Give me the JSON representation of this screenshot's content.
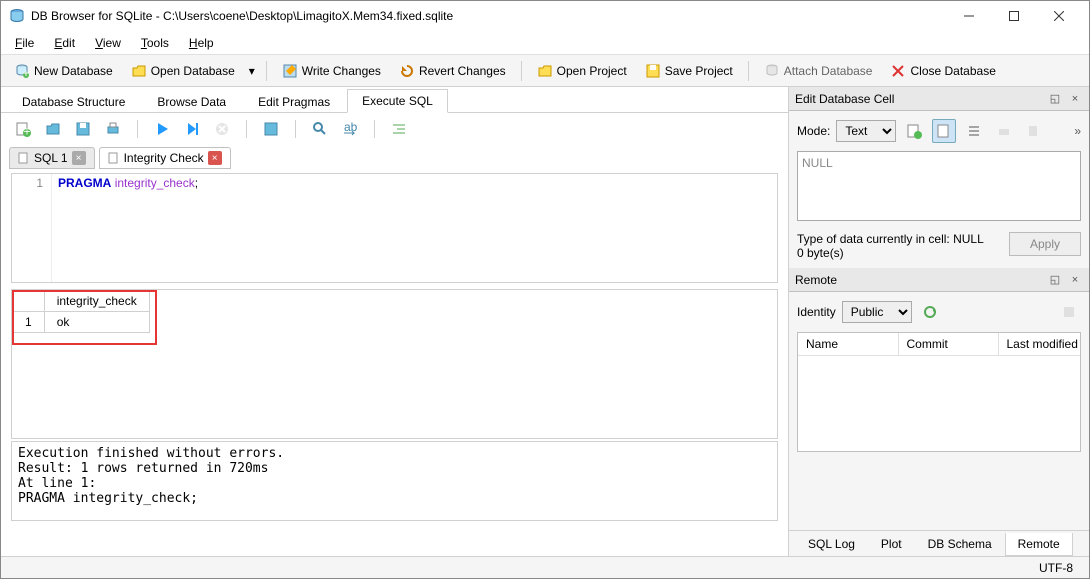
{
  "title": "DB Browser for SQLite - C:\\Users\\coene\\Desktop\\LimagitoX.Mem34.fixed.sqlite",
  "menu": {
    "file": "File",
    "edit": "Edit",
    "view": "View",
    "tools": "Tools",
    "help": "Help"
  },
  "toolbar": {
    "new_db": "New Database",
    "open_db": "Open Database",
    "write_changes": "Write Changes",
    "revert_changes": "Revert Changes",
    "open_project": "Open Project",
    "save_project": "Save Project",
    "attach_db": "Attach Database",
    "close_db": "Close Database"
  },
  "tabs": {
    "structure": "Database Structure",
    "browse": "Browse Data",
    "pragmas": "Edit Pragmas",
    "execute": "Execute SQL"
  },
  "sql_tabs": {
    "sql1": "SQL 1",
    "integrity": "Integrity Check"
  },
  "sql_text_kw": "PRAGMA",
  "sql_text_fn": "integrity_check",
  "result": {
    "header": "integrity_check",
    "rownum": "1",
    "value": "ok"
  },
  "log": "Execution finished without errors.\nResult: 1 rows returned in 720ms\nAt line 1:\nPRAGMA integrity_check;",
  "edit_cell": {
    "title": "Edit Database Cell",
    "mode_label": "Mode:",
    "mode_value": "Text",
    "null_text": "NULL",
    "type_info": "Type of data currently in cell: NULL",
    "size_info": "0 byte(s)",
    "apply": "Apply"
  },
  "remote": {
    "title": "Remote",
    "identity_label": "Identity",
    "identity_value": "Public",
    "cols": {
      "name": "Name",
      "commit": "Commit",
      "last_modified": "Last modified"
    }
  },
  "bottom_tabs": {
    "sql_log": "SQL Log",
    "plot": "Plot",
    "db_schema": "DB Schema",
    "remote": "Remote"
  },
  "status": {
    "encoding": "UTF-8"
  }
}
